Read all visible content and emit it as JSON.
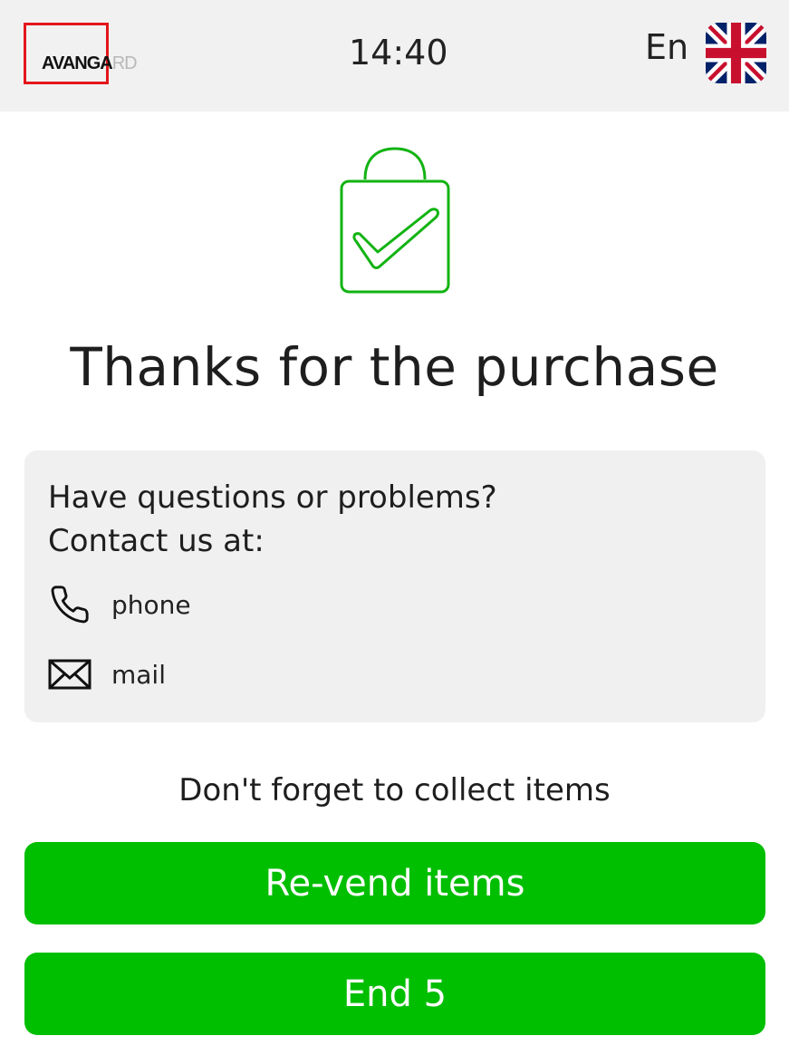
{
  "header": {
    "logo": {
      "text_dark": "AVANGA",
      "text_light": "RD",
      "brand_color": "#e3161b"
    },
    "time": "14:40",
    "language": {
      "label": "En",
      "flag_icon": "uk-flag-icon"
    }
  },
  "main": {
    "success_icon": "shopping-bag-check-icon",
    "accent_color": "#00be00",
    "title": "Thanks for the purchase",
    "contact": {
      "heading_line1": "Have questions or problems?",
      "heading_line2": "Contact us at:",
      "phone": {
        "icon": "phone-icon",
        "label": "phone"
      },
      "mail": {
        "icon": "mail-icon",
        "label": "mail"
      }
    },
    "reminder": "Don't forget to collect items",
    "buttons": {
      "revend_label": "Re-vend items",
      "end_label": "End 5"
    }
  }
}
